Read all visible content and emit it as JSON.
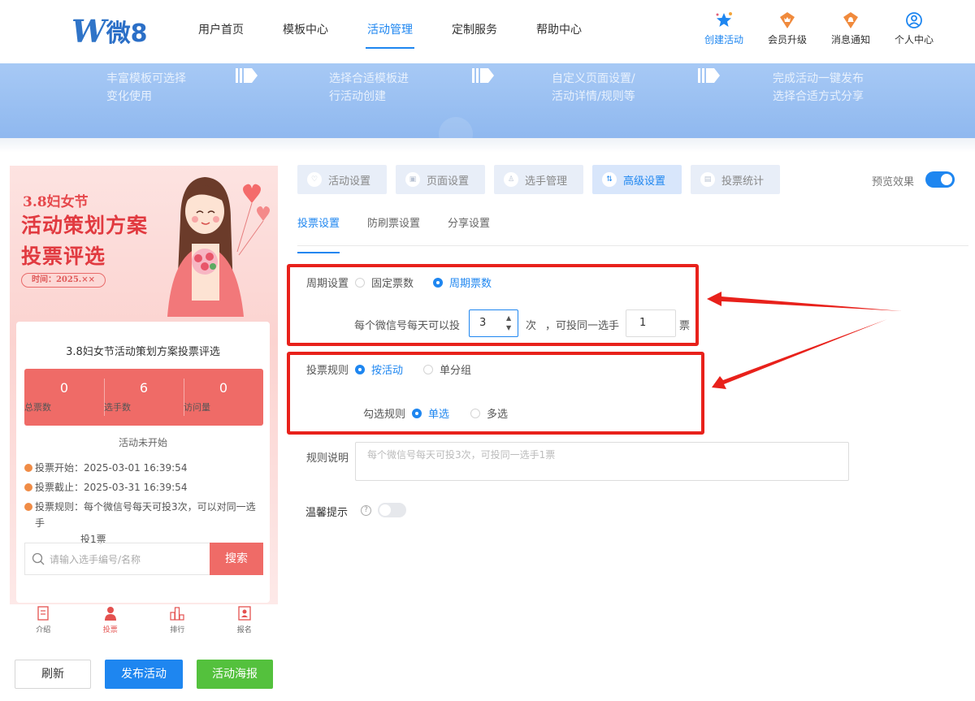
{
  "header": {
    "logo_text": "微8",
    "nav": [
      "用户首页",
      "模板中心",
      "活动管理",
      "定制服务",
      "帮助中心"
    ],
    "active_nav": "活动管理",
    "right_items": [
      {
        "label": "创建活动",
        "icon": "star-icon"
      },
      {
        "label": "会员升级",
        "icon": "crown-badge-icon"
      },
      {
        "label": "消息通知",
        "icon": "bell-badge-icon"
      },
      {
        "label": "个人中心",
        "icon": "user-circle-icon"
      }
    ]
  },
  "banner": {
    "steps": [
      {
        "line1": "丰富模板可选择",
        "line2": "变化使用"
      },
      {
        "line1": "选择合适模板进",
        "line2": "行活动创建"
      },
      {
        "line1": "自定义页面设置/",
        "line2": "活动详情/规则等"
      },
      {
        "line1": "完成活动一键发布",
        "line2": "选择合适方式分享"
      }
    ]
  },
  "preview": {
    "poster": {
      "line1": "3.8妇女节",
      "line2": "活动策划方案",
      "line3": "投票评选",
      "time_tag": "时间：2025.××"
    },
    "card_title": "3.8妇女节活动策划方案投票评选",
    "stats": [
      {
        "value": "0",
        "label": "总票数"
      },
      {
        "value": "6",
        "label": "选手数"
      },
      {
        "value": "0",
        "label": "访问量"
      }
    ],
    "status": "活动未开始",
    "info": {
      "start": "投票开始：2025-03-01 16:39:54",
      "end": "投票截止：2025-03-31 16:39:54",
      "rule": "投票规则：每个微信号每天可投3次，可以对同一选手",
      "rule2": "投1票"
    },
    "search_placeholder": "请输入选手编号/名称",
    "search_button": "搜索",
    "tabbar": [
      {
        "label": "介绍",
        "icon": "document-icon"
      },
      {
        "label": "投票",
        "icon": "person-icon"
      },
      {
        "label": "排行",
        "icon": "bar-rank-icon"
      },
      {
        "label": "报名",
        "icon": "signup-icon"
      }
    ],
    "active_tab": "投票"
  },
  "actions": {
    "refresh": "刷新",
    "publish": "发布活动",
    "poster": "活动海报"
  },
  "settings": {
    "top_tabs": [
      "活动设置",
      "页面设置",
      "选手管理",
      "高级设置",
      "投票统计"
    ],
    "active_top_tab": "高级设置",
    "preview_label": "预览效果",
    "preview_on": true,
    "sub_tabs": [
      "投票设置",
      "防刷票设置",
      "分享设置"
    ],
    "active_sub_tab": "投票设置",
    "cycle": {
      "label": "周期设置",
      "options": [
        "固定票数",
        "周期票数"
      ],
      "selected": "周期票数",
      "per_day_prefix": "每个微信号每天可以投",
      "per_day_value": "3",
      "times_unit": "次",
      "same_player_prefix": "，可投同一选手",
      "same_player_value": "1",
      "votes_unit": "票"
    },
    "rule": {
      "label": "投票规则",
      "options": [
        "按活动",
        "单分组"
      ],
      "selected": "按活动",
      "check_label": "勾选规则",
      "check_options": [
        "单选",
        "多选"
      ],
      "check_selected": "单选"
    },
    "desc": {
      "label": "规则说明",
      "placeholder": "每个微信号每天可投3次，可投同一选手1票"
    },
    "tip": {
      "label": "温馨提示",
      "enabled": false
    }
  },
  "colors": {
    "accent": "#1e86f0",
    "highlight_border": "#e8211b",
    "stats_bg": "#ef6b67",
    "poster_button": "#54c13d"
  }
}
